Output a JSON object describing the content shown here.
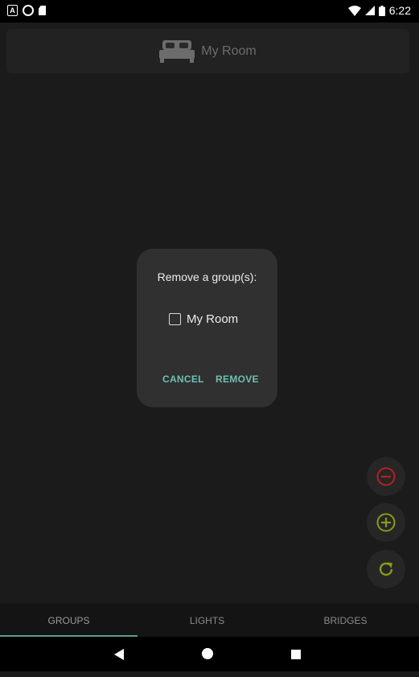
{
  "status_bar": {
    "time": "6:22",
    "icons": [
      "a-notification-icon",
      "circle-notification-icon",
      "sd-card-icon",
      "wifi-icon",
      "signal-icon",
      "battery-icon"
    ]
  },
  "header": {
    "title": "My Room",
    "icon": "bed-icon"
  },
  "dialog": {
    "title": "Remove a group(s):",
    "options": [
      {
        "label": "My Room",
        "checked": false
      }
    ],
    "cancel_label": "CANCEL",
    "remove_label": "REMOVE"
  },
  "fabs": [
    {
      "icon": "remove-circle-icon",
      "color": "#b82020"
    },
    {
      "icon": "add-circle-icon",
      "color": "#8a9a18"
    },
    {
      "icon": "refresh-icon",
      "color": "#8a9a18"
    }
  ],
  "tabs": [
    {
      "label": "GROUPS",
      "selected": true
    },
    {
      "label": "LIGHTS",
      "selected": false
    },
    {
      "label": "BRIDGES",
      "selected": false
    }
  ],
  "colors": {
    "accent": "#6fbfb3",
    "background": "#1b1b1b",
    "dialog": "#303030"
  }
}
